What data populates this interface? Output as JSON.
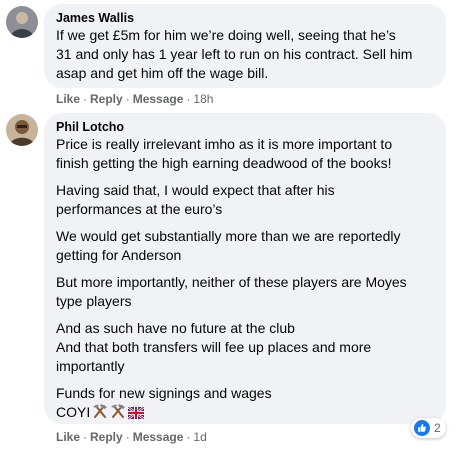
{
  "comments": [
    {
      "author": "James Wallis",
      "lines": [
        "If we get £5m for him we’re doing well, seeing that he’s",
        "31 and only has 1 year left to run on his contract. Sell him",
        "asap and get him off the wage bill."
      ],
      "actions": {
        "like": "Like",
        "reply": "Reply",
        "message": "Message",
        "time": "18h"
      }
    },
    {
      "author": "Phil Lotcho",
      "paragraphs": [
        {
          "lines": [
            "Price is really irrelevant imho as it is more important to",
            "finish getting the high earning deadwood of the books!"
          ]
        },
        {
          "lines": [
            "Having said that, I would expect that after his",
            "performances at the euro’s"
          ]
        },
        {
          "lines": [
            "We would get substantially more than we are reportedly",
            "getting for Anderson"
          ]
        },
        {
          "lines": [
            "But more importantly, neither of these players are Moyes",
            "type players"
          ]
        },
        {
          "lines": [
            "And as such have no future at the club",
            "And that both transfers will fee up places and more",
            "importantly"
          ]
        },
        {
          "lines": [
            "Funds for new signings and wages",
            "COYI"
          ]
        }
      ],
      "emojis": [
        "hammer-and-pick",
        "hammer-and-pick",
        "uk-flag"
      ],
      "actions": {
        "like": "Like",
        "reply": "Reply",
        "message": "Message",
        "time": "1d"
      },
      "reactions": {
        "type": "like",
        "count": "2"
      }
    }
  ],
  "colors": {
    "bubble": "#f0f2f5",
    "secondary_text": "#65676b",
    "like_blue": "#1877f2"
  }
}
